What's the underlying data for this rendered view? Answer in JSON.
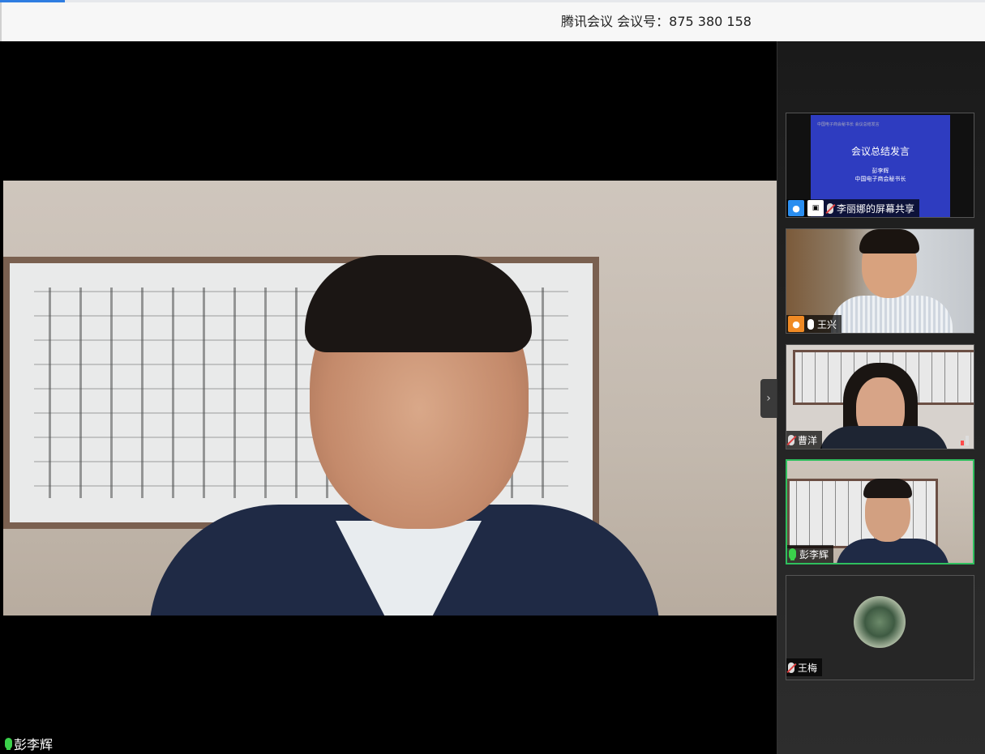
{
  "window": {
    "title": "腾讯会议 会议号：875 380 158"
  },
  "main_video": {
    "participant_name": "彭李辉",
    "mic_state": "speaking"
  },
  "sidebar": {
    "collapse_icon": "chevron-right-icon",
    "participants": [
      {
        "name": "李丽娜的屏幕共享",
        "type": "screen-share",
        "mic_state": "muted",
        "slide": {
          "header": "中国电子商会秘书长 会议总结发言",
          "title": "会议总结发言",
          "subtitle_1": "彭李辉",
          "subtitle_2": "中国电子商会秘书长"
        }
      },
      {
        "name": "王兴",
        "type": "video",
        "mic_state": "on"
      },
      {
        "name": "曹洋",
        "type": "video",
        "mic_state": "muted"
      },
      {
        "name": "彭李辉",
        "type": "video",
        "mic_state": "speaking",
        "active_speaker": true
      },
      {
        "name": "王梅",
        "type": "avatar",
        "mic_state": "muted"
      }
    ]
  },
  "colors": {
    "speaking_border": "#2fbf5e",
    "user_icon_blue": "#2a8ef0",
    "user_icon_orange": "#f08a24",
    "mic_green": "#3bd14b"
  }
}
